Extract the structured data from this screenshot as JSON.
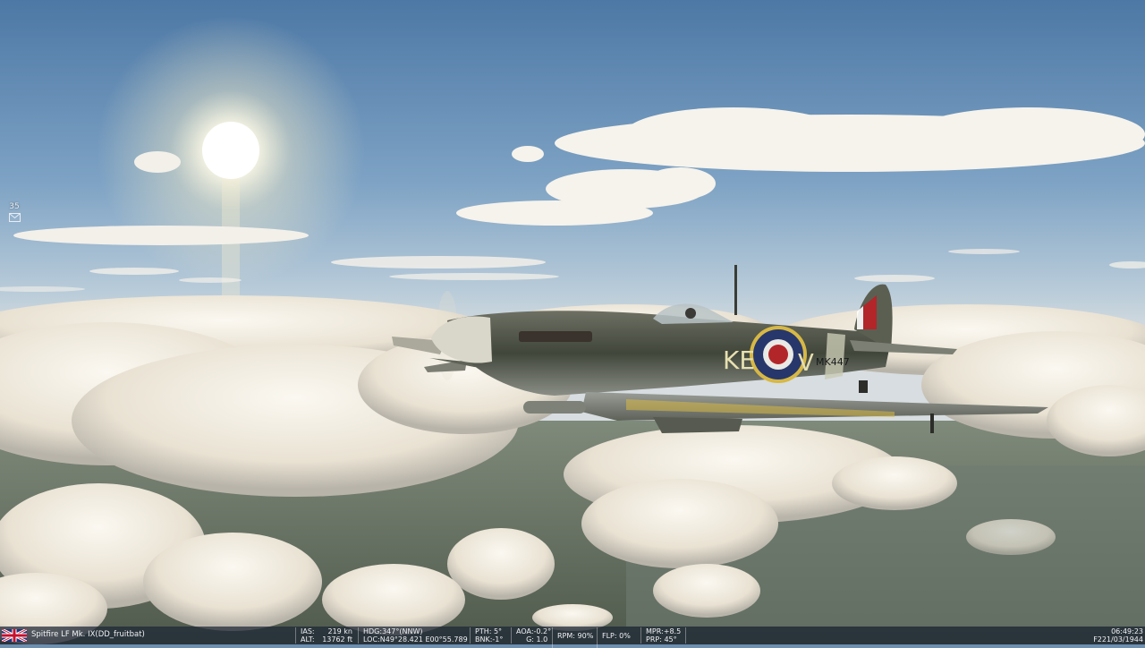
{
  "game": {
    "aircraft": "Spitfire LF Mk. IX(DD_fruitbat)",
    "squadron_code": "KE",
    "individual_letter": "V",
    "serial": "MK447",
    "nationality_flag": "union-jack-flag-icon"
  },
  "side_icons": {
    "fps_text": "35",
    "envelope_icon": "envelope-icon"
  },
  "hud": {
    "ias_label": "IAS:",
    "ias_value": "219 kn",
    "alt_label": "ALT:",
    "alt_value": "13762 ft",
    "hdg_label": "HDG:",
    "hdg_value": "347°(NNW)",
    "loc_label": "LOC:",
    "loc_value": "N49°28.421 E00°55.789",
    "pth_label": "PTH:",
    "pth_value": "5°",
    "bnk_label": "BNK:",
    "bnk_value": "-1°",
    "aoa_label": "AOA:",
    "aoa_value": "-0.2°",
    "g_label": "G:",
    "g_value": "1.0",
    "rpm_label": "RPM:",
    "rpm_value": "90%",
    "flp_label": "FLP:",
    "flp_value": "0%",
    "mpr_label": "MPR:",
    "mpr_value": "+8.5",
    "prp_label": "PRP:",
    "prp_value": "45°",
    "time": "06:49:23",
    "date": "F221/03/1944"
  },
  "colors": {
    "hud_bg": "#1c2634",
    "hud_text": "#f0f2f5",
    "sky_top": "#4f7aa6",
    "cloud": "#f4f1ea",
    "roundel_red": "#b2262a",
    "roundel_blue": "#27376b",
    "roundel_yellow": "#d7b845"
  }
}
